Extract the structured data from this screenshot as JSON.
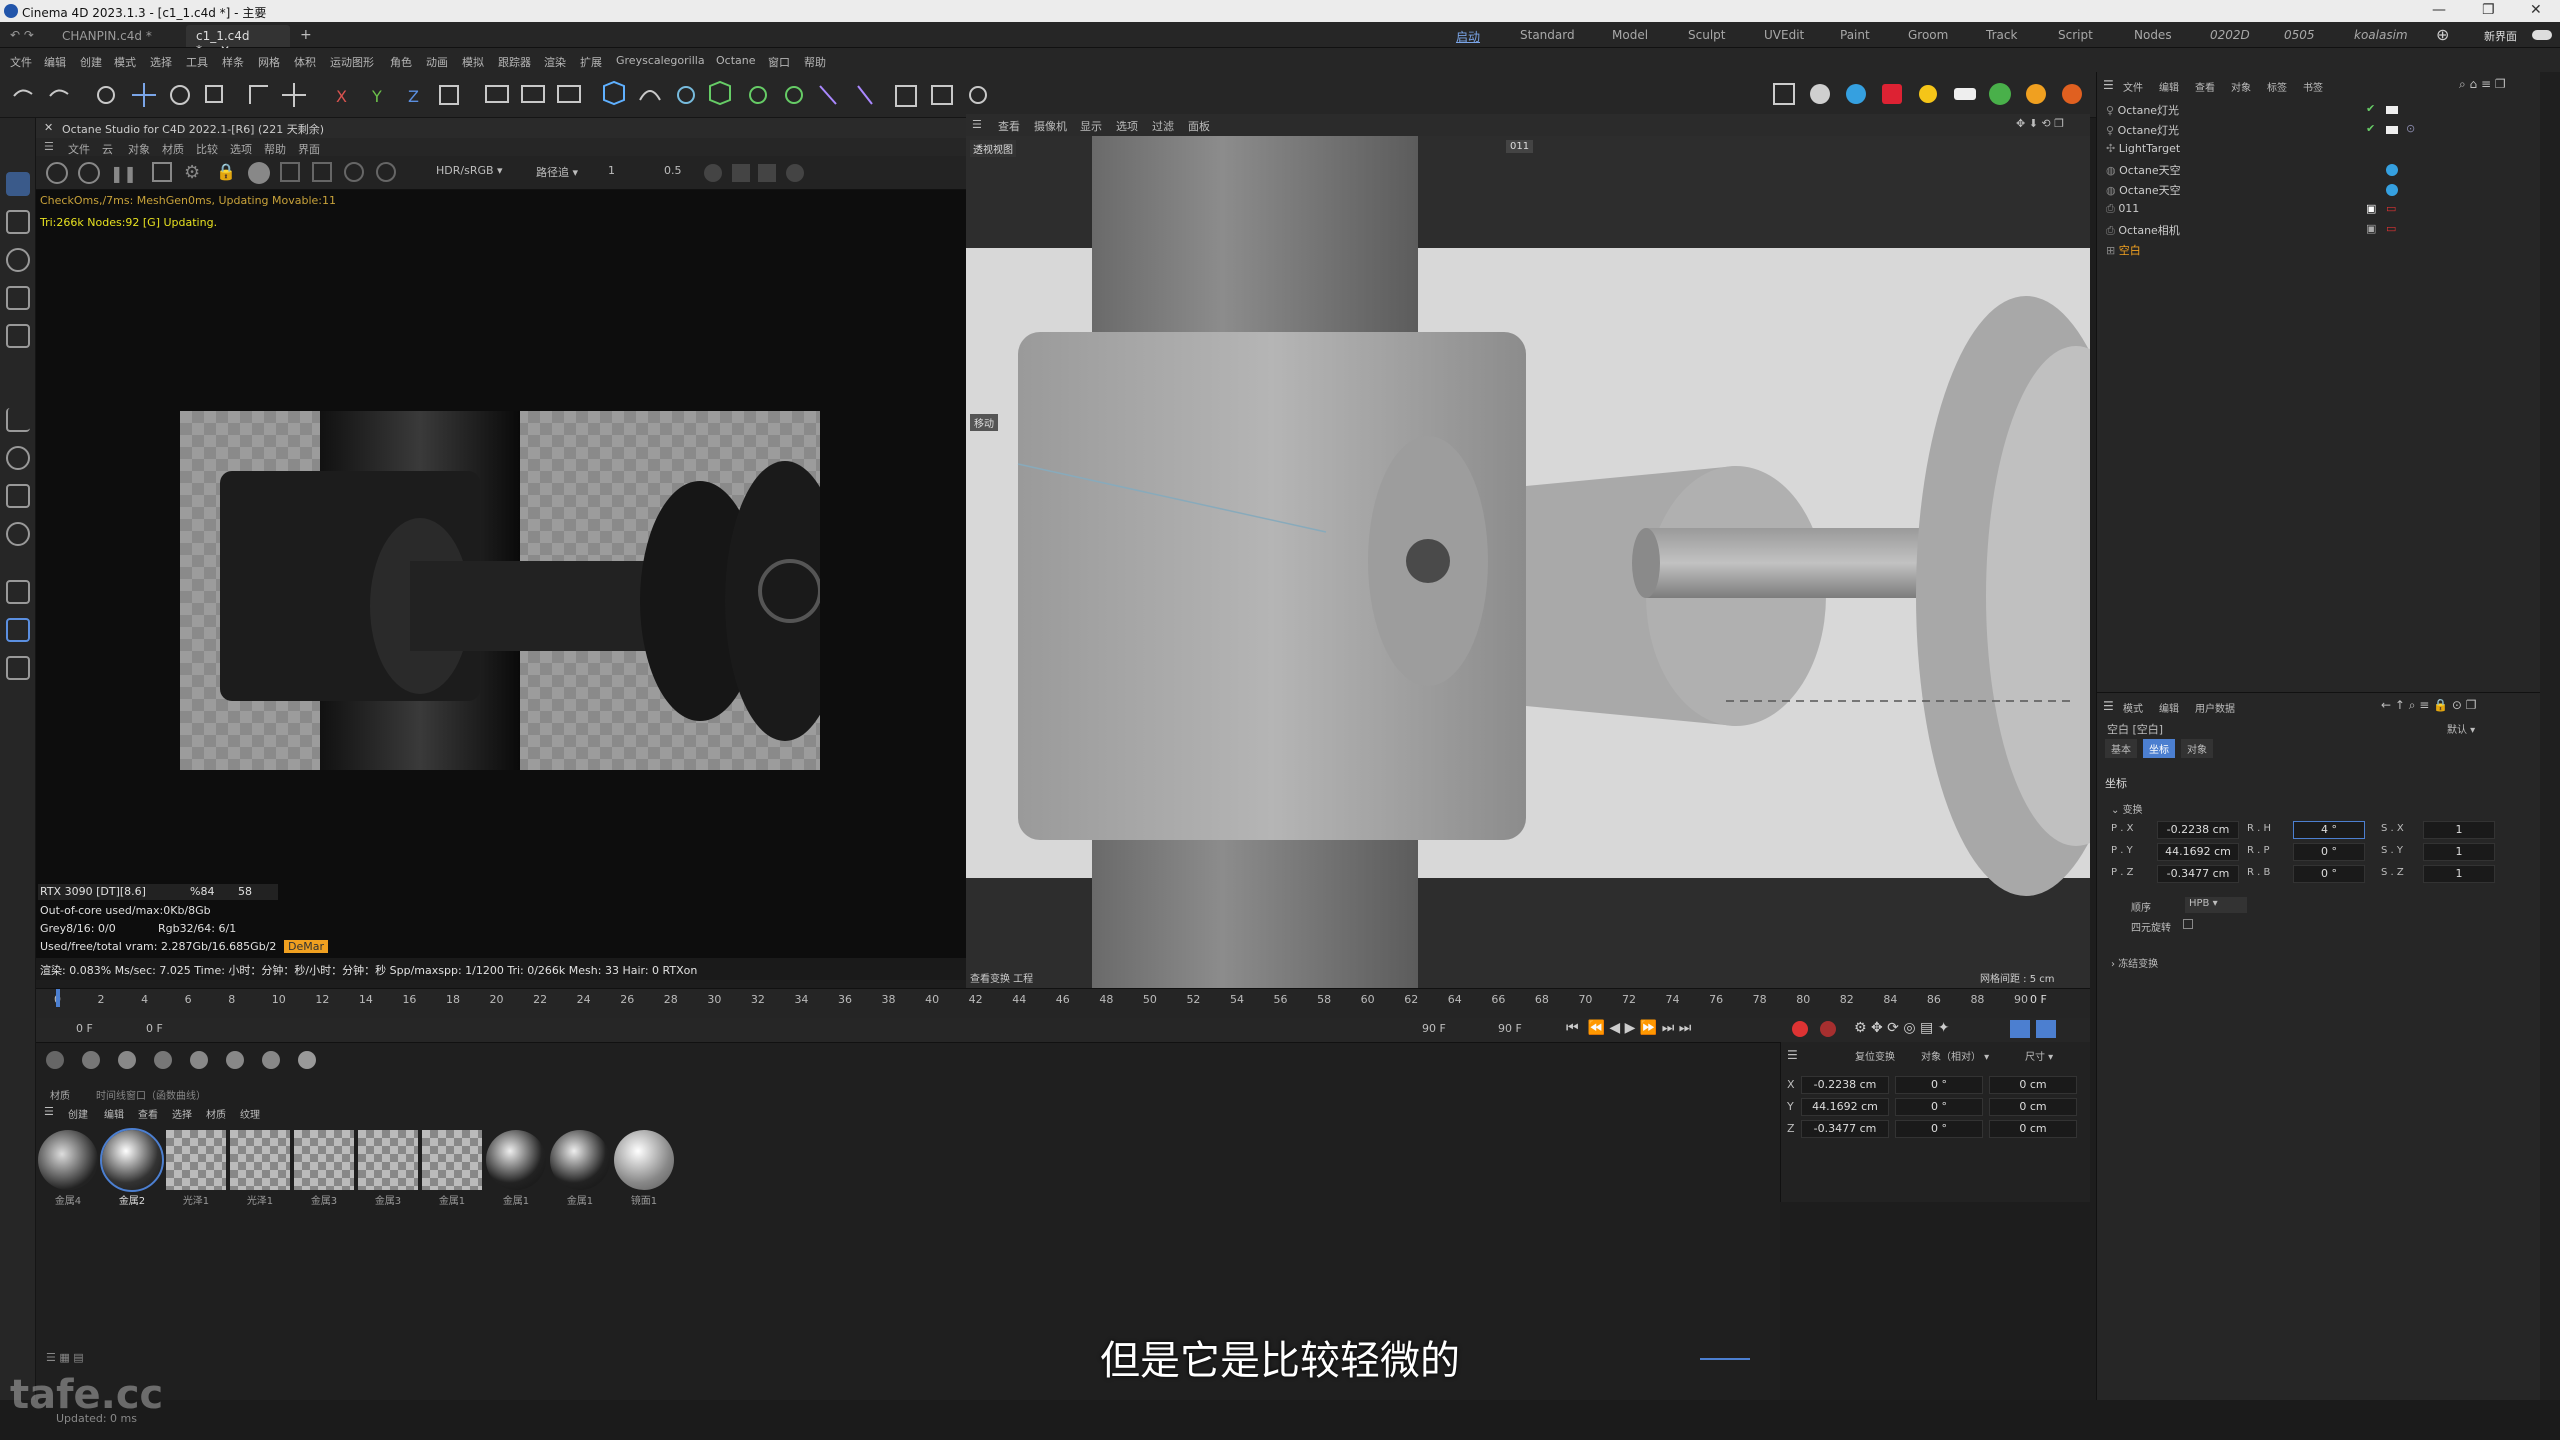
{
  "window": {
    "title": "Cinema 4D 2023.1.3 - [c1_1.c4d *] - 主要"
  },
  "doc_tabs": [
    {
      "label": "CHANPIN.c4d *"
    },
    {
      "label": "c1_1.c4d *"
    }
  ],
  "layout_tabs": [
    "启动",
    "Standard",
    "Model",
    "Sculpt",
    "UVEdit",
    "Paint",
    "Groom",
    "Track",
    "Script",
    "Nodes",
    "0202D",
    "0505",
    "koalasim"
  ],
  "new_layout_label": "新界面",
  "menu": [
    "文件",
    "编辑",
    "创建",
    "模式",
    "选择",
    "工具",
    "样条",
    "网格",
    "体积",
    "运动图形",
    "角色",
    "动画",
    "模拟",
    "跟踪器",
    "渲染",
    "扩展",
    "Greyscalegorilla",
    "Octane",
    "窗口",
    "帮助"
  ],
  "octane": {
    "title": "Octane Studio for C4D 2022.1-[R6] (221 天剩余)",
    "menu": [
      "文件",
      "云",
      "对象",
      "材质",
      "比较",
      "选项",
      "帮助",
      "界面"
    ],
    "color_mode": "HDR/sRGB",
    "mode_select": "路径追",
    "value_a": "1",
    "value_b": "0.5",
    "status_line1": "CheckOms,/7ms: MeshGen0ms, Updating Movable:11",
    "status_line2": "Tri:266k Nodes:92  [G] Updating.",
    "gpu_line": "RTX 3090 [DT][8.6]",
    "gpu_pct": "%84",
    "gpu_temp": "58",
    "outofcore": "Out-of-core used/max:0Kb/8Gb",
    "grey_line": "Grey8/16: 0/0",
    "rgb_line": "Rgb32/64: 6/1",
    "vram": "Used/free/total vram: 2.287Gb/16.685Gb/2",
    "vram_badge": "DeMar",
    "render_line": "渲染:  0.083%    Ms/sec: 7.025    Time: 小时：分钟：秒/小时：分钟：秒   Spp/maxspp: 1/1200   Tri: 0/266k    Mesh: 33    Hair: 0    RTXon"
  },
  "viewport": {
    "menu": [
      "查看",
      "摄像机",
      "显示",
      "选项",
      "过滤",
      "面板"
    ],
    "label": "透视视图",
    "camera_tag": "011",
    "move_label": "移动",
    "bottom_left": "查看变换  工程",
    "grid_label": "网格间距 : 5 cm"
  },
  "timeline": {
    "ticks": [
      "0",
      "2",
      "4",
      "6",
      "8",
      "10",
      "12",
      "14",
      "16",
      "18",
      "20",
      "22",
      "24",
      "26",
      "28",
      "30",
      "32",
      "34",
      "36",
      "38",
      "40",
      "42",
      "44",
      "46",
      "48",
      "50",
      "52",
      "54",
      "56",
      "58",
      "60",
      "62",
      "64",
      "66",
      "68",
      "70",
      "72",
      "74",
      "76",
      "78",
      "80",
      "82",
      "84",
      "86",
      "88",
      "90"
    ],
    "frame_end_label": "0 F",
    "start_frame": "0 F",
    "current_frame": "0 F",
    "end_frame_a": "90 F",
    "end_frame_b": "90 F"
  },
  "materials": {
    "tabs": [
      "材质",
      "时间线窗口（函数曲线）"
    ],
    "menu": [
      "创建",
      "编辑",
      "查看",
      "选择",
      "材质",
      "纹理"
    ],
    "items": [
      {
        "label": "金属4"
      },
      {
        "label": "金属2"
      },
      {
        "label": "光泽1"
      },
      {
        "label": "光泽1"
      },
      {
        "label": "金属3"
      },
      {
        "label": "金属3"
      },
      {
        "label": "金属1"
      },
      {
        "label": "金属1"
      },
      {
        "label": "金属1"
      },
      {
        "label": "镜面1"
      }
    ]
  },
  "coords": {
    "header": [
      "复位变换",
      "对象（相对）",
      "尺寸"
    ],
    "rows": [
      {
        "axis": "X",
        "pos": "-0.2238 cm",
        "rot": "0 °",
        "size": "0 cm"
      },
      {
        "axis": "Y",
        "pos": "44.1692 cm",
        "rot": "0 °",
        "size": "0 cm"
      },
      {
        "axis": "Z",
        "pos": "-0.3477 cm",
        "rot": "0 °",
        "size": "0 cm"
      }
    ]
  },
  "object_manager": {
    "menu": [
      "文件",
      "编辑",
      "查看",
      "对象",
      "标签",
      "书签"
    ],
    "objects": [
      {
        "name": "Octane灯光"
      },
      {
        "name": "Octane灯光"
      },
      {
        "name": "LightTarget"
      },
      {
        "name": "Octane天空"
      },
      {
        "name": "Octane天空"
      },
      {
        "name": "011"
      },
      {
        "name": "Octane相机"
      },
      {
        "name": "空白"
      }
    ]
  },
  "attributes": {
    "menu": [
      "模式",
      "编辑",
      "用户数据"
    ],
    "object_label": "空白 [空白]",
    "preset": "默认",
    "tabs": [
      "基本",
      "坐标",
      "对象"
    ],
    "section": "坐标",
    "transform_group": "变换",
    "fields": [
      {
        "label": "P . X",
        "value": "-0.2238 cm",
        "rlabel": "R . H",
        "rvalue": "4 °",
        "slabel": "S . X",
        "svalue": "1"
      },
      {
        "label": "P . Y",
        "value": "44.1692 cm",
        "rlabel": "R . P",
        "rvalue": "0 °",
        "slabel": "S . Y",
        "svalue": "1"
      },
      {
        "label": "P . Z",
        "value": "-0.3477 cm",
        "rlabel": "R . B",
        "rvalue": "0 °",
        "slabel": "S . Z",
        "svalue": "1"
      }
    ],
    "order_label": "顺序",
    "order_value": "HPB",
    "quat_label": "四元旋转",
    "freeze_label": "冻结变换"
  },
  "status": {
    "text": "Updated: 0 ms"
  },
  "subtitle": "但是它是比较轻微的",
  "watermark": "tafe.cc",
  "colors": {
    "accent": "#4c7fd0",
    "render_bg": "#0d0d0d",
    "viewport_bg": "#d9d9d9",
    "highlight": "#f0a020"
  }
}
